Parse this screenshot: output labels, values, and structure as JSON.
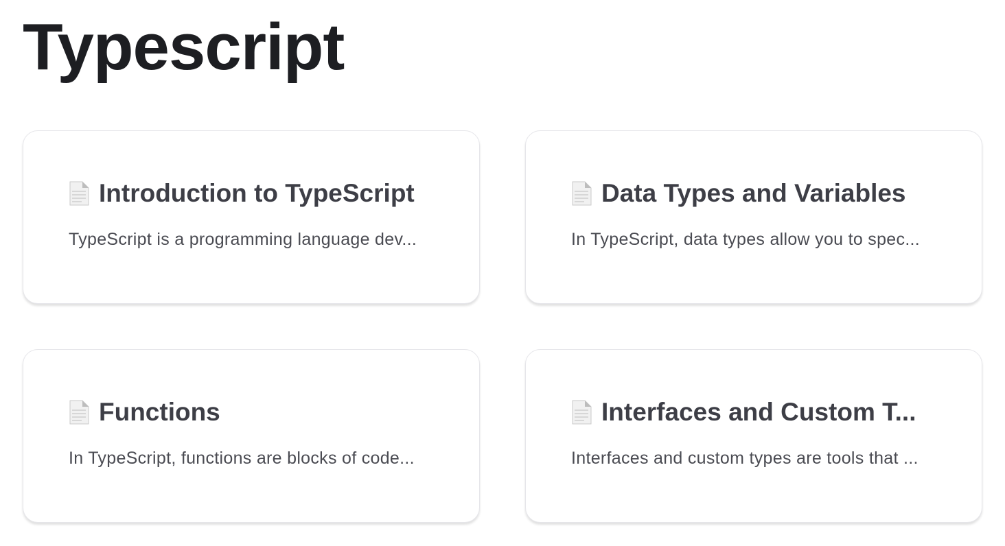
{
  "page": {
    "title": "Typescript"
  },
  "cards": [
    {
      "icon": "document-icon",
      "title": "Introduction to TypeScript",
      "description": "TypeScript is a programming language dev..."
    },
    {
      "icon": "document-icon",
      "title": "Data Types and Variables",
      "description": "In TypeScript, data types allow you to spec..."
    },
    {
      "icon": "document-icon",
      "title": "Functions",
      "description": "In TypeScript, functions are blocks of code..."
    },
    {
      "icon": "document-icon",
      "title": "Interfaces and Custom T...",
      "description": "Interfaces and custom types are tools that ..."
    }
  ]
}
